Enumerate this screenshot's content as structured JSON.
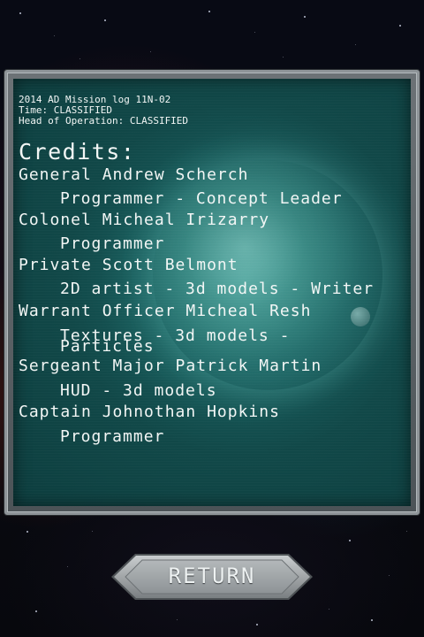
{
  "mission_log": {
    "line1": "2014 AD Mission log 11N-02",
    "line2": "Time: CLASSIFIED",
    "line3": "Head of Operation: CLASSIFIED"
  },
  "credits": {
    "title": "Credits:",
    "entries": [
      {
        "name": "General Andrew Scherch",
        "role": "Programmer - Concept Leader"
      },
      {
        "name": "Colonel Micheal Irizarry",
        "role": "Programmer"
      },
      {
        "name": "Private Scott Belmont",
        "role": "2D artist - 3d models - Writer"
      },
      {
        "name": "Warrant Officer Micheal Resh",
        "role": "Textures - 3d models -\nParticles"
      },
      {
        "name": "Sergeant Major Patrick Martin",
        "role": "HUD - 3d models"
      },
      {
        "name": "Captain Johnothan Hopkins",
        "role": "Programmer"
      }
    ]
  },
  "return_button": {
    "label": "RETURN"
  },
  "colors": {
    "panel_teal": "#175a5a",
    "frame_gray": "#8e9498",
    "text": "#f2f6f5",
    "button_gray": "#a3a7a9"
  }
}
